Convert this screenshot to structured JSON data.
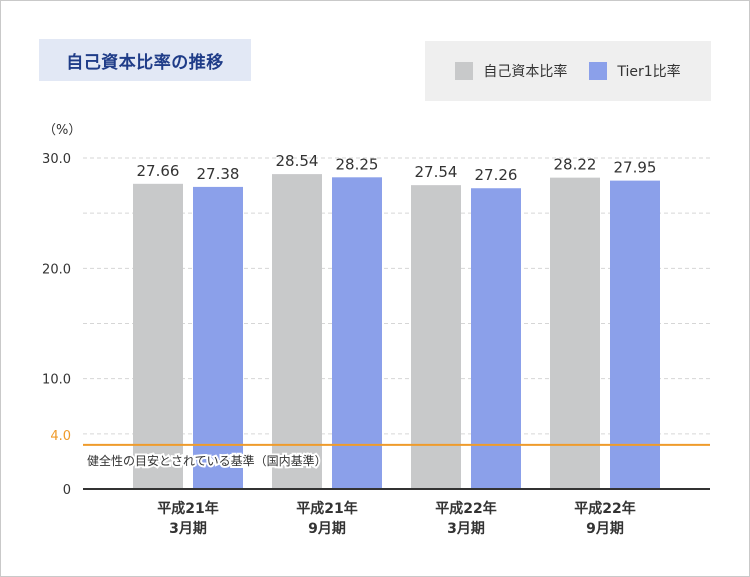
{
  "title": "自己資本比率の推移",
  "legend": [
    {
      "label": "自己資本比率",
      "color": "#c8c9ca"
    },
    {
      "label": "Tier1比率",
      "color": "#8ba0ea"
    }
  ],
  "unit_label": "（%）",
  "reference": {
    "value": 4.0,
    "tick_label": "4.0",
    "label": "健全性の目安とされている基準（国内基準）",
    "color": "#ef9b2b"
  },
  "chart_data": {
    "type": "bar",
    "title": "自己資本比率の推移",
    "categories": [
      [
        "平成21年",
        "3月期"
      ],
      [
        "平成21年",
        "9月期"
      ],
      [
        "平成22年",
        "3月期"
      ],
      [
        "平成22年",
        "9月期"
      ]
    ],
    "series": [
      {
        "name": "自己資本比率",
        "color": "#c8c9ca",
        "values": [
          27.66,
          28.54,
          27.54,
          28.22
        ],
        "labels": [
          "27.66",
          "28.54",
          "27.54",
          "28.22"
        ]
      },
      {
        "name": "Tier1比率",
        "color": "#8ba0ea",
        "values": [
          27.38,
          28.25,
          27.26,
          27.95
        ],
        "labels": [
          "27.38",
          "28.25",
          "27.26",
          "27.95"
        ]
      }
    ],
    "ylim": [
      0,
      30
    ],
    "yticks": [
      0,
      10,
      20,
      30
    ],
    "ytick_labels": [
      "0",
      "10.0",
      "20.0",
      "30.0"
    ],
    "grid": true,
    "legend_position": "top-right"
  }
}
